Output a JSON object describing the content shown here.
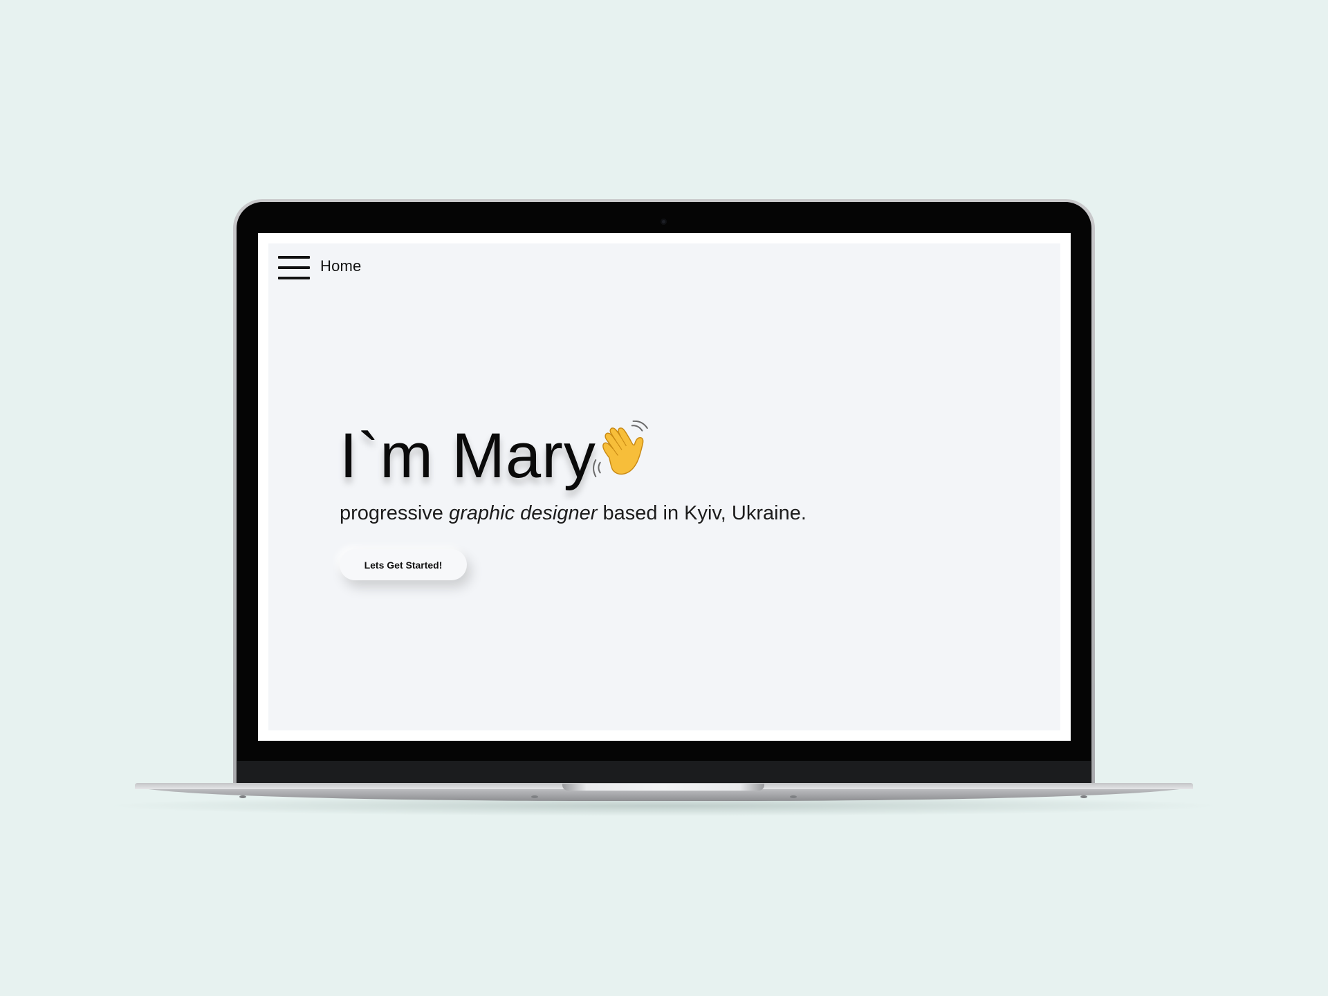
{
  "nav": {
    "menu_icon": "hamburger-menu-icon",
    "home_label": "Home"
  },
  "hero": {
    "title": "I`m Mary",
    "wave_icon": "waving-hand-icon",
    "subtitle_before": "progressive ",
    "subtitle_emphasis": "graphic designer",
    "subtitle_after": " based in Kyiv, Ukraine.",
    "cta_label": "Lets Get Started!"
  },
  "colors": {
    "background": "#e7f2f0",
    "screen": "#f3f5f8",
    "text": "#0a0a0a",
    "emoji": "#f7be3a"
  }
}
